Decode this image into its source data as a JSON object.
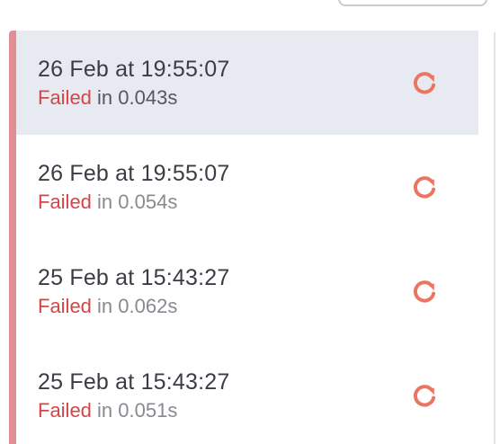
{
  "colors": {
    "failed": "#d64545",
    "accent_stripe": "#e18d94",
    "retry_icon": "#ea7662",
    "selected_background": "#e8eaf1"
  },
  "runs": [
    {
      "time": "26 Feb at 19:55:07",
      "status": "Failed",
      "duration": "in 0.043s",
      "icon": "retry-icon",
      "selected": true
    },
    {
      "time": "26 Feb at 19:55:07",
      "status": "Failed",
      "duration": "in 0.054s",
      "icon": "retry-icon",
      "selected": false
    },
    {
      "time": "25 Feb at 15:43:27",
      "status": "Failed",
      "duration": "in 0.062s",
      "icon": "retry-icon",
      "selected": false
    },
    {
      "time": "25 Feb at 15:43:27",
      "status": "Failed",
      "duration": "in 0.051s",
      "icon": "retry-icon",
      "selected": false
    }
  ]
}
